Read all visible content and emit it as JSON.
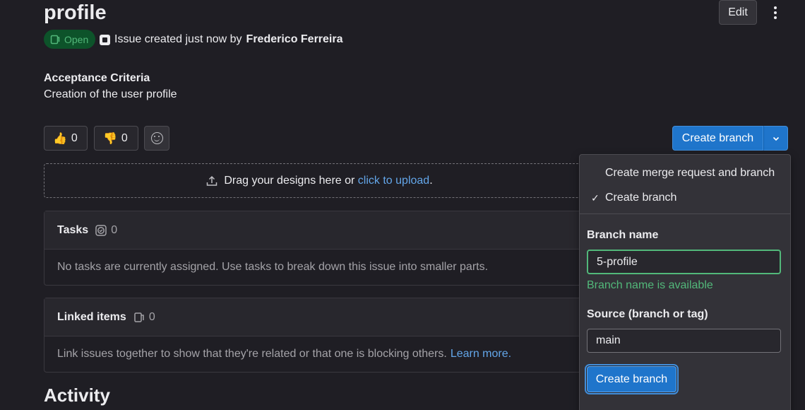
{
  "issue": {
    "title": "profile",
    "status": "Open",
    "created_text": "Issue created just now by",
    "author": "Frederico Ferreira",
    "edit_label": "Edit"
  },
  "description": {
    "heading": "Acceptance Criteria",
    "text": "Creation of the user profile"
  },
  "reactions": {
    "thumbs_up_count": "0",
    "thumbs_down_count": "0"
  },
  "create_branch": {
    "label": "Create branch"
  },
  "upload": {
    "text": "Drag your designs here or",
    "link": "click to upload",
    "suffix": "."
  },
  "tasks": {
    "title": "Tasks",
    "count": "0",
    "empty": "No tasks are currently assigned. Use tasks to break down this issue into smaller parts."
  },
  "linked": {
    "title": "Linked items",
    "count": "0",
    "empty": "Link issues together to show that they're related or that one is blocking others.",
    "learn_more": "Learn more."
  },
  "activity": {
    "heading": "Activity"
  },
  "dropdown": {
    "option_mr": "Create merge request and branch",
    "option_branch": "Create branch",
    "branch_name_label": "Branch name",
    "branch_name_value": "5-profile",
    "branch_available": "Branch name is available",
    "source_label": "Source (branch or tag)",
    "source_value": "main",
    "submit_label": "Create branch"
  },
  "colors": {
    "background": "#1f1e24",
    "accent": "#1f75cb",
    "link": "#63a6e9",
    "success": "#52b87a"
  }
}
